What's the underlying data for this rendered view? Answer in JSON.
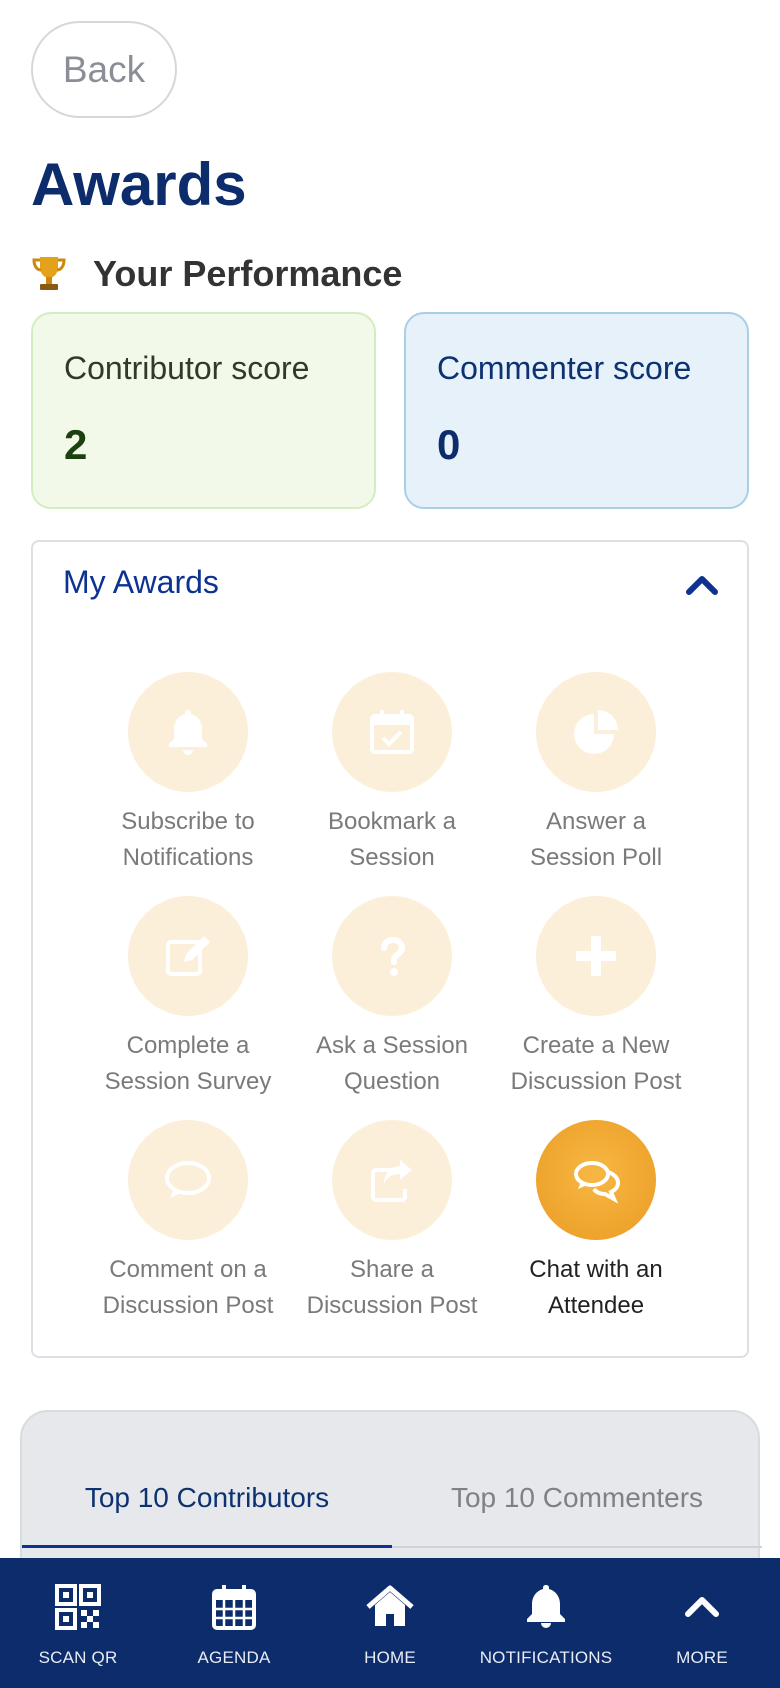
{
  "header": {
    "back_label": "Back",
    "title": "Awards"
  },
  "performance": {
    "heading": "Your Performance",
    "contributor": {
      "label": "Contributor score",
      "value": "2"
    },
    "commenter": {
      "label": "Commenter score",
      "value": "0"
    }
  },
  "awards": {
    "heading": "My Awards",
    "items": [
      {
        "line1": "Subscribe to",
        "line2": "Notifications",
        "icon": "bell-icon",
        "earned": false
      },
      {
        "line1": "Bookmark a",
        "line2": "Session",
        "icon": "calendar-check-icon",
        "earned": false
      },
      {
        "line1": "Answer a",
        "line2": "Session Poll",
        "icon": "pie-chart-icon",
        "earned": false
      },
      {
        "line1": "Complete a",
        "line2": "Session Survey",
        "icon": "edit-icon",
        "earned": false
      },
      {
        "line1": "Ask a Session",
        "line2": "Question",
        "icon": "question-icon",
        "earned": false
      },
      {
        "line1": "Create a New",
        "line2": "Discussion Post",
        "icon": "plus-icon",
        "earned": false
      },
      {
        "line1": "Comment on a",
        "line2": "Discussion Post",
        "icon": "comment-icon",
        "earned": false
      },
      {
        "line1": "Share a",
        "line2": "Discussion Post",
        "icon": "share-icon",
        "earned": false
      },
      {
        "line1": "Chat with an",
        "line2": "Attendee",
        "icon": "comments-icon",
        "earned": true
      }
    ]
  },
  "leaderboard": {
    "tab_contributors": "Top 10 Contributors",
    "tab_commenters": "Top 10 Commenters"
  },
  "nav": {
    "scan": "SCAN QR",
    "agenda": "AGENDA",
    "home": "HOME",
    "notifications": "NOTIFICATIONS",
    "more": "MORE"
  },
  "colors": {
    "brand": "#0d2c6c",
    "accent": "#f0a530",
    "award_inactive": "#fcefd9"
  }
}
